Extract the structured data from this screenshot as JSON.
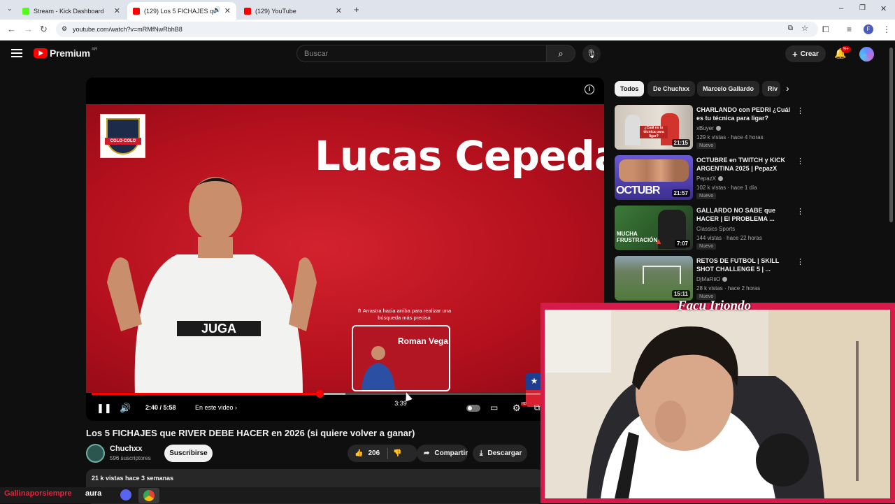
{
  "browser": {
    "tabs": [
      {
        "title": "Stream - Kick Dashboard",
        "favicon_color": "#53fc18"
      },
      {
        "title": "(129) Los 5 FICHAJES que R",
        "favicon_color": "#ff0000"
      },
      {
        "title": "(129) YouTube",
        "favicon_color": "#ff0000"
      }
    ],
    "url": "youtube.com/watch?v=mRMfNwRbhB8",
    "profile_initial": "F"
  },
  "header": {
    "logo_text": "Premium",
    "country_code": "AR",
    "search_placeholder": "Buscar",
    "create_label": "Crear",
    "notifications_badge": "9+"
  },
  "player": {
    "overlay_name": "Lucas Cepeda",
    "club_label": "COLO-COLO",
    "seek_hint": "⤊ Arrastra hacia arriba para realizar una búsqueda más precisa",
    "preview_name": "Roman Vega",
    "preview_time": "3:39",
    "current_time": "2:40",
    "duration": "5:58",
    "time_label": "2:40 / 5:58",
    "played_fraction": 0.45,
    "buffered_fraction": 0.5,
    "in_this_video": "En este video",
    "settings_badge": "HD"
  },
  "video": {
    "title": "Los 5 FICHAJES que RIVER DEBE HACER en 2026 (si quiere volver a ganar)",
    "channel": "Chuchxx",
    "subscribers": "596 suscriptores",
    "subscribe_label": "Suscribirse",
    "likes": "206",
    "share_label": "Compartir",
    "download_label": "Descargar",
    "views_date": "21 k vistas  hace 3 semanas"
  },
  "chips": [
    "Todos",
    "De Chuchxx",
    "Marcelo Gallardo",
    "Riv"
  ],
  "recommendations": [
    {
      "title": "CHARLANDO con PEDRI ¿Cuál es tu técnica para ligar?",
      "channel": "xBuyer",
      "meta": "129 k vistas · hace 4 horas",
      "badge": "Nuevo",
      "duration": "21:15",
      "thumb_text": "¿Cuál es tu técnica para ligar?"
    },
    {
      "title": "OCTUBRE en TWITCH y KICK ARGENTINA 2025 | PepazX",
      "channel": "PepazX",
      "meta": "102 k vistas · hace 1 día",
      "badge": "Nuevo",
      "duration": "21:57",
      "thumb_text": "OCTUBR"
    },
    {
      "title": "GALLARDO NO SABE que HACER | El PROBLEMA ...",
      "channel": "Classics Sports",
      "meta": "144 vistas · hace 22 horas",
      "badge": "Nuevo",
      "duration": "7:07",
      "thumb_text": "MUCHA FRUSTRACIÓN"
    },
    {
      "title": "RETOS DE FUTBOL | SKILL SHOT CHALLENGE 5 | ...",
      "channel": "DjMaRiiO",
      "meta": "28 k vistas · hace 2 horas",
      "badge": "Nuevo",
      "duration": "15:11",
      "thumb_text": ""
    }
  ],
  "webcam": {
    "name": "Facu Iriondo"
  },
  "overlay_text": {
    "left": "Gallinaporsiempre",
    "right": "aura"
  },
  "colors": {
    "youtube_red": "#ff0000",
    "background": "#0f0f0f",
    "webcam_border": "#d61a4a"
  }
}
